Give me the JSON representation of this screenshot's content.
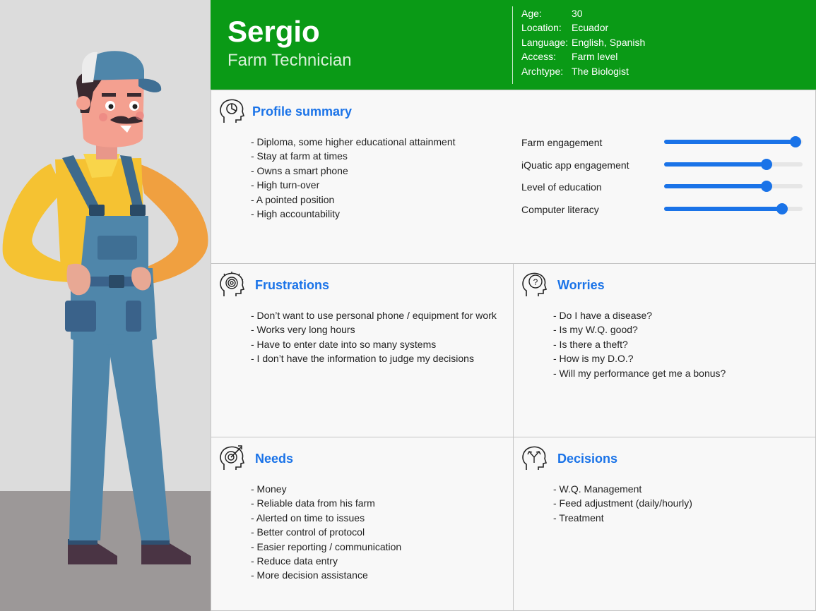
{
  "persona": {
    "name": "Sergio",
    "role": "Farm Technician",
    "facts": [
      {
        "key": "Age:",
        "value": "30"
      },
      {
        "key": "Location:",
        "value": "Ecuador"
      },
      {
        "key": "Language:",
        "value": "English, Spanish"
      },
      {
        "key": "Access:",
        "value": "Farm level"
      },
      {
        "key": "Archtype:",
        "value": "The Biologist"
      }
    ]
  },
  "profile": {
    "title": "Profile summary",
    "items": [
      "- Diploma, some higher educational attainment",
      "- Stay at farm at times",
      "- Owns a smart phone",
      "- High turn-over",
      "- A pointed position",
      "- High accountability"
    ],
    "metrics": [
      {
        "label": "Farm engagement",
        "level": 0.95
      },
      {
        "label": "iQuatic app engagement",
        "level": 0.74
      },
      {
        "label": "Level of education",
        "level": 0.74
      },
      {
        "label": "Computer literacy",
        "level": 0.85
      }
    ]
  },
  "frustrations": {
    "title": "Frustrations",
    "items": [
      "- Don’t want to use personal phone / equipment for work",
      "- Works very long hours",
      "- Have to enter date into so many systems",
      "- I don’t have the information to judge my decisions"
    ]
  },
  "worries": {
    "title": "Worries",
    "items": [
      "- Do I have a disease?",
      "- Is my W.Q. good?",
      "- Is there a theft?",
      "- How is my D.O.?",
      "- Will my performance get me a bonus?"
    ]
  },
  "needs": {
    "title": "Needs",
    "items": [
      "- Money",
      "- Reliable data from his farm",
      "- Alerted on time to issues",
      "- Better control of protocol",
      "- Easier reporting / communication",
      "- Reduce data entry",
      "- More decision assistance"
    ]
  },
  "decisions": {
    "title": "Decisions",
    "items": [
      "- W.Q. Management",
      "- Feed adjustment (daily/hourly)",
      "- Treatment"
    ]
  },
  "colors": {
    "header_green": "#0a9a16",
    "accent_blue": "#1a73e8"
  },
  "icons": {
    "profile": "head-chart-icon",
    "frustrations": "head-spiral-icon",
    "worries": "head-question-icon",
    "needs": "head-target-icon",
    "decisions": "head-arrows-icon"
  }
}
